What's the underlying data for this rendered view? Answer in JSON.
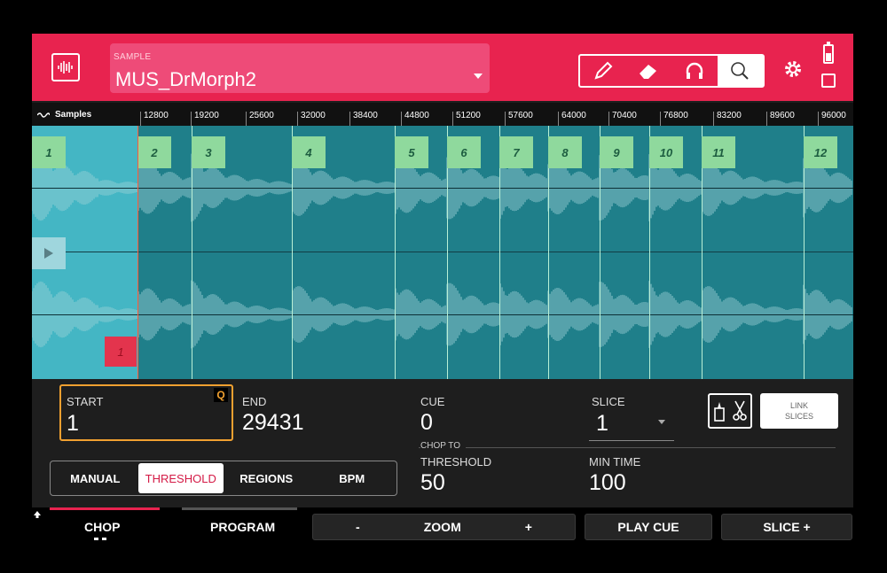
{
  "header": {
    "sample_label": "SAMPLE",
    "sample_name": "MUS_DrMorph2",
    "tools": [
      "pencil-icon",
      "eraser-icon",
      "headphones-icon",
      "zoom-icon"
    ],
    "active_tool": "zoom-icon"
  },
  "ruler": {
    "label": "Samples",
    "ticks": [
      "12800",
      "19200",
      "25600",
      "32000",
      "38400",
      "44800",
      "51200",
      "57600",
      "64000",
      "70400",
      "76800",
      "83200",
      "89600",
      "96000"
    ]
  },
  "slices": [
    "1",
    "2",
    "3",
    "4",
    "5",
    "6",
    "7",
    "8",
    "9",
    "10",
    "11",
    "12"
  ],
  "cue_marker": "1",
  "controls": {
    "start_label": "START",
    "start_value": "1",
    "q_badge": "Q",
    "end_label": "END",
    "end_value": "29431",
    "cue_label": "CUE",
    "cue_value": "0",
    "slice_label": "SLICE",
    "slice_value": "1",
    "link_slices_line1": "LINK",
    "link_slices_line2": "SLICES",
    "chop_to": "CHOP TO",
    "threshold_label": "THRESHOLD",
    "threshold_value": "50",
    "min_time_label": "MIN TIME",
    "min_time_value": "100",
    "modes": [
      "MANUAL",
      "THRESHOLD",
      "REGIONS",
      "BPM"
    ],
    "active_mode": "THRESHOLD"
  },
  "bottom": {
    "tab_chop": "CHOP",
    "tab_program": "PROGRAM",
    "zoom_minus": "-",
    "zoom_label": "ZOOM",
    "zoom_plus": "+",
    "play_cue": "PLAY CUE",
    "slice_plus": "SLICE +"
  },
  "colors": {
    "header": "#e8234f",
    "waveform_bg": "#1f7f8a",
    "slice_tag": "#8fd99d",
    "start_highlight": "#f0a030"
  }
}
